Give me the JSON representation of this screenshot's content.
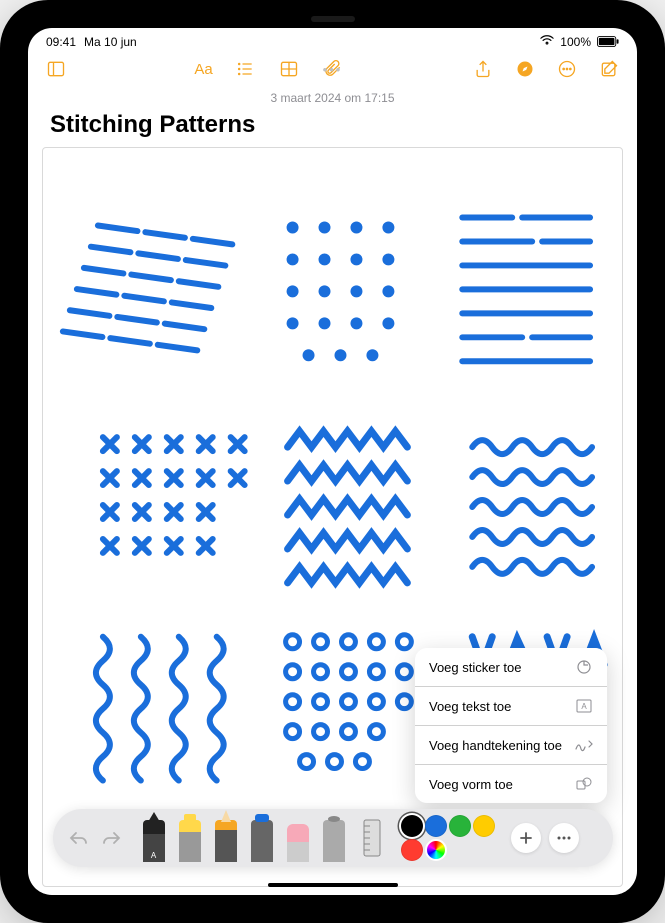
{
  "status": {
    "time": "09:41",
    "date": "Ma 10 jun",
    "wifi_icon": "wifi",
    "battery_pct": "100%"
  },
  "toolbar": {
    "sidebar_icon": "sidebar",
    "format_label": "Aa",
    "timestamp": "3 maart 2024 om 17:15"
  },
  "note": {
    "title": "Stitching Patterns"
  },
  "popup": {
    "items": [
      {
        "label": "Voeg sticker toe",
        "icon": "sticker"
      },
      {
        "label": "Voeg tekst toe",
        "icon": "textbox"
      },
      {
        "label": "Voeg handtekening toe",
        "icon": "signature"
      },
      {
        "label": "Voeg vorm toe",
        "icon": "shapes"
      }
    ]
  },
  "colors": [
    {
      "hex": "#000000",
      "selected": true
    },
    {
      "hex": "#1a6edb"
    },
    {
      "hex": "#28b33a"
    },
    {
      "hex": "#ffcc00"
    },
    {
      "hex": "#ff3b30"
    },
    {
      "picker": true
    }
  ],
  "tools": [
    "pen",
    "marker",
    "pencil",
    "crayon",
    "eraser",
    "lasso"
  ]
}
